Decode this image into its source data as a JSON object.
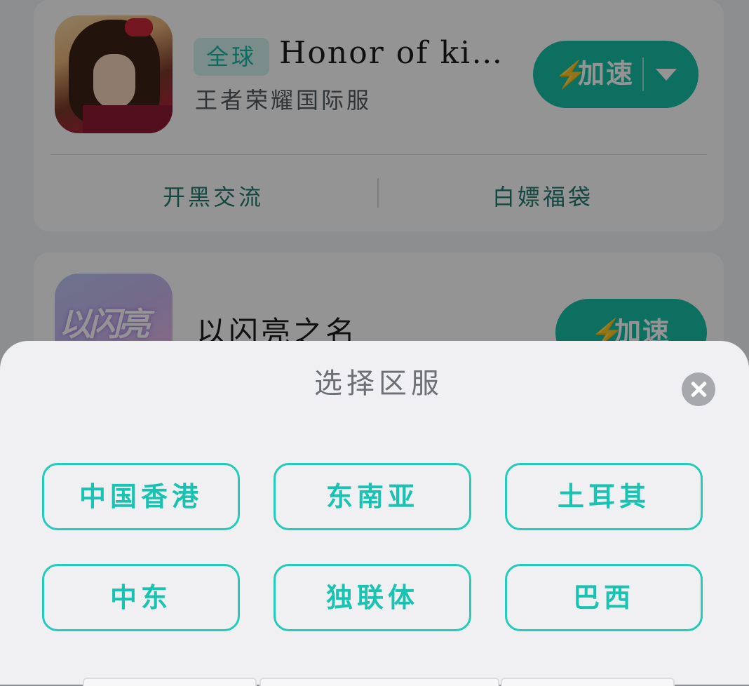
{
  "games": [
    {
      "region_tag": "全球",
      "title": "Honor of ki…",
      "subtitle": "王者荣耀国际服",
      "speed_label": "加速",
      "links": [
        "开黑交流",
        "白嫖福袋"
      ]
    },
    {
      "title": "以闪亮之名",
      "speed_label": "加速",
      "icon_text": "以闪亮"
    }
  ],
  "sheet": {
    "title": "选择区服",
    "servers": [
      "中国香港",
      "东南亚",
      "土耳其",
      "中东",
      "独联体",
      "巴西"
    ]
  },
  "icons": {
    "bolt": "⚡",
    "close": "close-icon",
    "caret": "chevron-down-icon"
  },
  "colors": {
    "accent": "#15bfa6",
    "server_text": "#19c3b2",
    "server_border": "#23cbbb",
    "sheet_bg": "#f0f0f2"
  }
}
